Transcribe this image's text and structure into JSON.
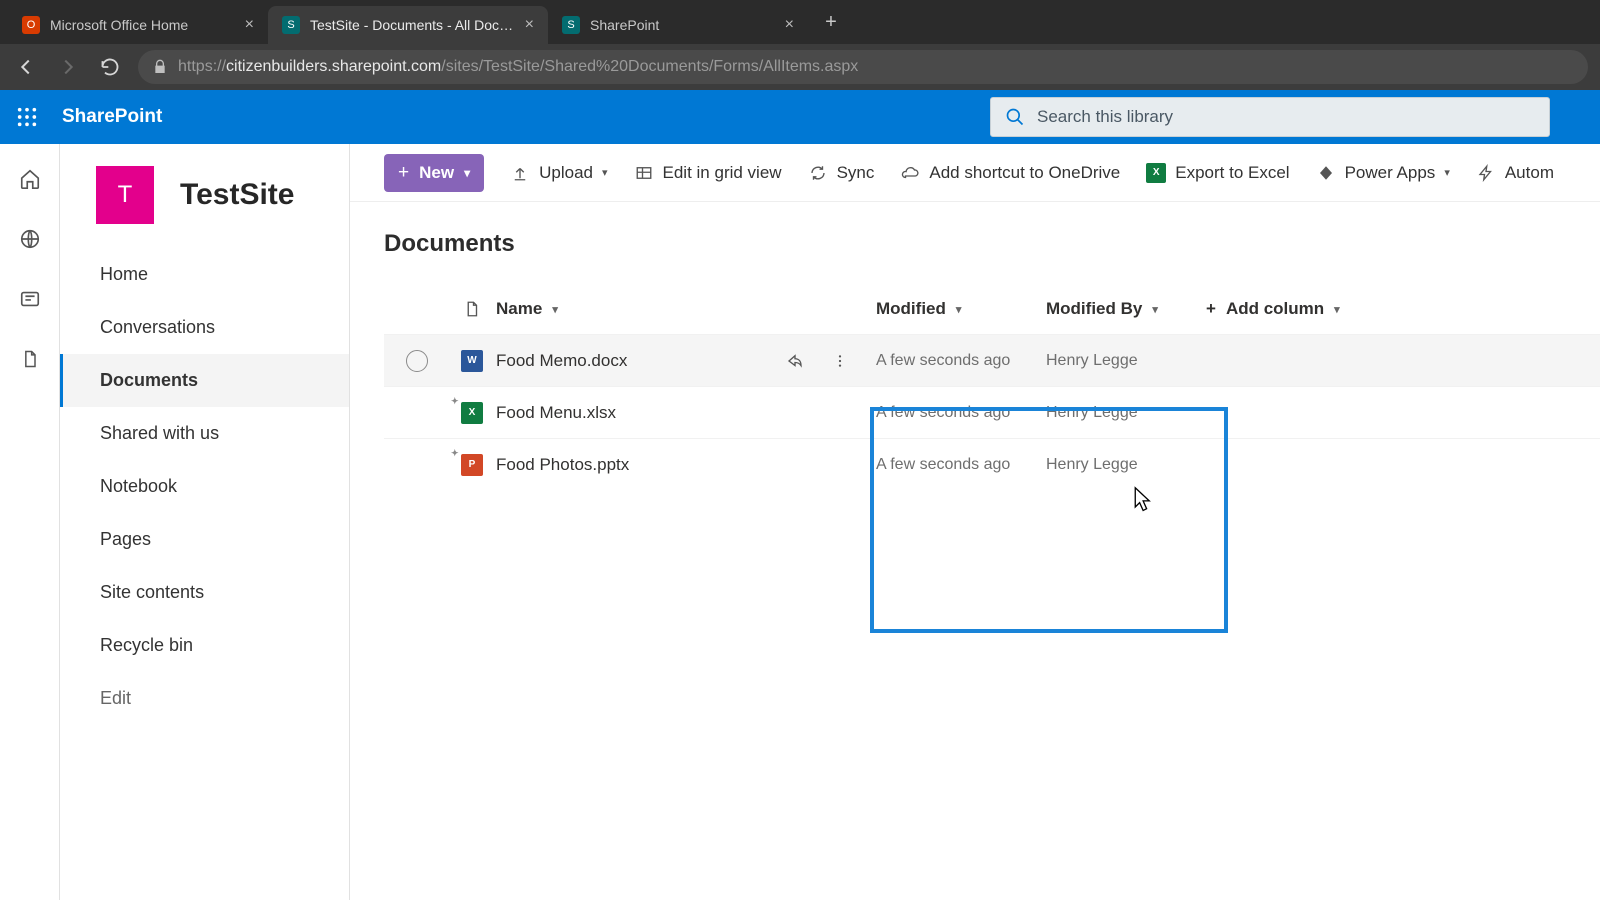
{
  "browser": {
    "tabs": [
      {
        "title": "Microsoft Office Home",
        "favicon": "office",
        "active": false
      },
      {
        "title": "TestSite - Documents - All Docum",
        "favicon": "sp",
        "active": true
      },
      {
        "title": "SharePoint",
        "favicon": "sp",
        "active": false
      }
    ],
    "url_prefix": "https://",
    "url_host": "citizenbuilders.sharepoint.com",
    "url_path": "/sites/TestSite/Shared%20Documents/Forms/AllItems.aspx"
  },
  "suite": {
    "product": "SharePoint",
    "search_placeholder": "Search this library"
  },
  "site": {
    "logo_letter": "T",
    "name": "TestSite"
  },
  "nav": {
    "items": [
      {
        "label": "Home",
        "selected": false
      },
      {
        "label": "Conversations",
        "selected": false
      },
      {
        "label": "Documents",
        "selected": true
      },
      {
        "label": "Shared with us",
        "selected": false
      },
      {
        "label": "Notebook",
        "selected": false
      },
      {
        "label": "Pages",
        "selected": false
      },
      {
        "label": "Site contents",
        "selected": false
      },
      {
        "label": "Recycle bin",
        "selected": false
      }
    ],
    "edit": "Edit"
  },
  "commands": {
    "new": "New",
    "upload": "Upload",
    "edit_grid": "Edit in grid view",
    "sync": "Sync",
    "add_shortcut": "Add shortcut to OneDrive",
    "export_excel": "Export to Excel",
    "power_apps": "Power Apps",
    "automate": "Autom"
  },
  "library": {
    "title": "Documents",
    "columns": {
      "name": "Name",
      "modified": "Modified",
      "modified_by": "Modified By",
      "add_column": "Add column"
    },
    "rows": [
      {
        "name": "Food Memo.docx",
        "type": "word",
        "modified": "A few seconds ago",
        "by": "Henry Legge",
        "hovered": true,
        "loading": false
      },
      {
        "name": "Food Menu.xlsx",
        "type": "excel",
        "modified": "A few seconds ago",
        "by": "Henry Legge",
        "hovered": false,
        "loading": true
      },
      {
        "name": "Food Photos.pptx",
        "type": "ppt",
        "modified": "A few seconds ago",
        "by": "Henry Legge",
        "hovered": false,
        "loading": true
      }
    ]
  }
}
